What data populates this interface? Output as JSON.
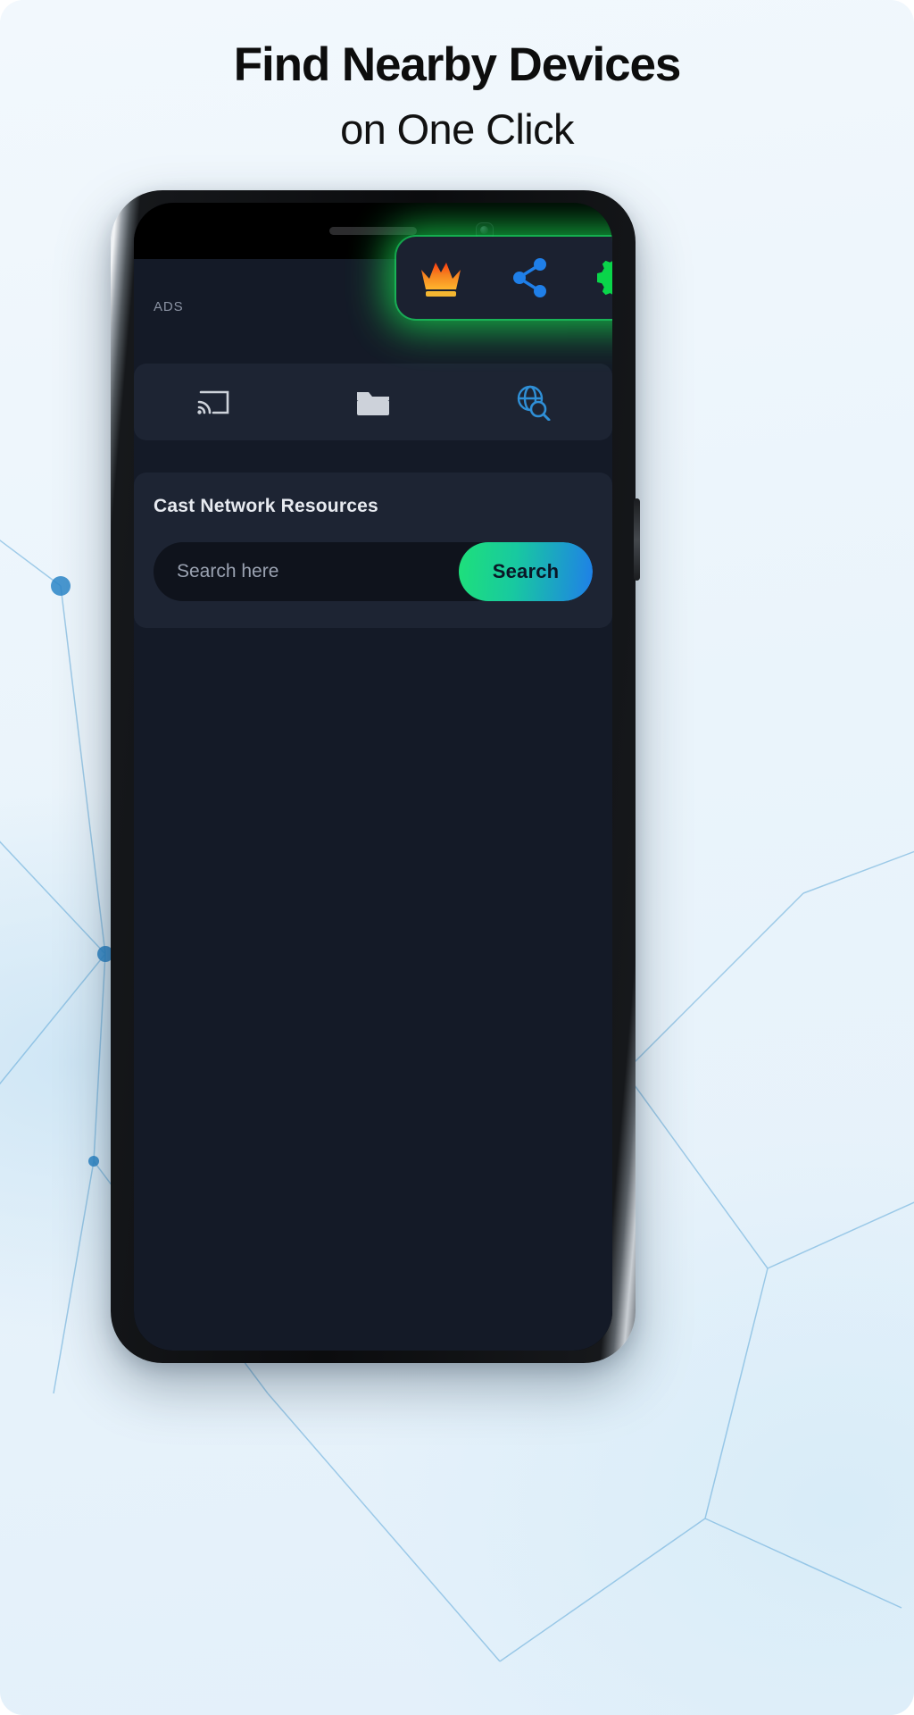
{
  "headline": {
    "line1": "Find Nearby Devices",
    "line2": "on One Click"
  },
  "colors": {
    "accent_green": "#16c64a",
    "accent_blue": "#1f7fe8",
    "crown_orange": "#f5821f",
    "page_bg": "#eaf4fb",
    "app_bg": "#141a27",
    "card_bg": "#1d2433",
    "input_bg": "#0f131c"
  },
  "phone": {
    "ads_label": "ADS",
    "toolbar": {
      "items": [
        {
          "name": "premium-crown-icon",
          "label": "Premium"
        },
        {
          "name": "share-icon",
          "label": "Share"
        },
        {
          "name": "settings-gear-icon",
          "label": "Settings"
        }
      ]
    },
    "tabs": [
      {
        "name": "cast-icon",
        "label": "Cast"
      },
      {
        "name": "folder-icon",
        "label": "Files"
      },
      {
        "name": "network-search-icon",
        "label": "Network Search"
      }
    ],
    "card": {
      "title": "Cast Network Resources",
      "search_placeholder": "Search here",
      "search_value": "",
      "search_button": "Search"
    }
  }
}
